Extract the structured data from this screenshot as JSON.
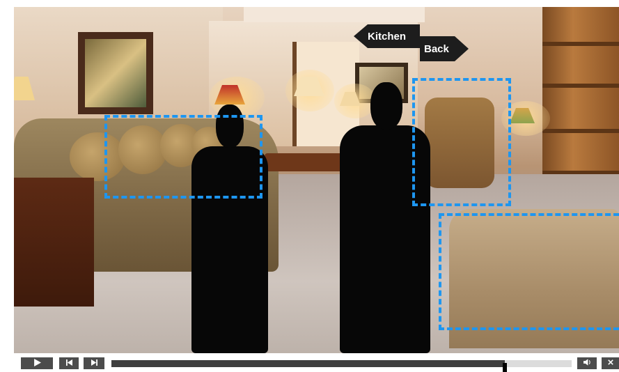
{
  "navigation": {
    "left_label": "Kitchen",
    "right_label": "Back"
  },
  "player": {
    "progress_fraction": 0.855,
    "buttons": {
      "play": "play-icon",
      "previous": "skip-back-icon",
      "next": "skip-forward-icon",
      "volume": "volume-icon",
      "close": "close-icon"
    }
  },
  "colors": {
    "hotspot_border": "#1e96f0",
    "control_button": "#4c4c4c",
    "arrow_background": "#1d1d1d"
  }
}
